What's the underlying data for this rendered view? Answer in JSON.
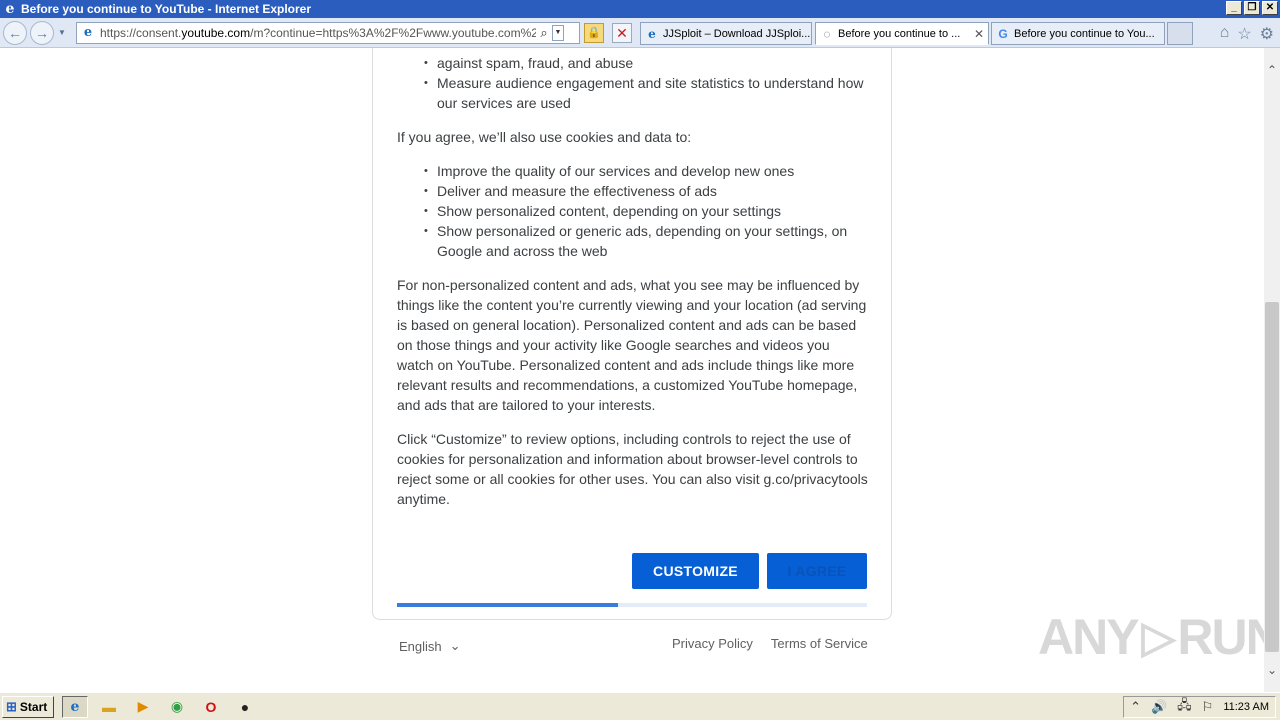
{
  "window": {
    "title": "Before you continue to YouTube - Internet Explorer",
    "btn_minimize": "_",
    "btn_restore": "❐",
    "btn_close": "✕"
  },
  "nav": {
    "back_glyph": "←",
    "forward_glyph": "→",
    "dropdown_glyph": "▼",
    "url_prefix": "https://consent.",
    "url_host": "youtube.com",
    "url_rest": "/m?continue=https%3A%2F%2Fwww.youtube.com%2Fchann",
    "lock_glyph": "🔒",
    "stop_glyph": "✕"
  },
  "tabs": [
    {
      "label": "JJSploit – Download JJSploi...",
      "icon": "e"
    },
    {
      "label": "Before you continue to ...",
      "icon": "◌"
    },
    {
      "label": "Before you continue to You...",
      "icon": "G"
    }
  ],
  "toolbar": {
    "home": "⌂",
    "favorites": "☆",
    "settings": "⚙"
  },
  "content": {
    "bullets_top": [
      "against spam, fraud, and abuse",
      "Measure audience engagement and site statistics to understand how our services are used"
    ],
    "agree_intro": "If you agree, we’ll also use cookies and data to:",
    "bullets_agree": [
      "Improve the quality of our services and develop new ones",
      "Deliver and measure the effectiveness of ads",
      "Show personalized content, depending on your settings",
      "Show personalized or generic ads, depending on your settings, on Google and across the web"
    ],
    "para_nonpersonalized": "For non-personalized content and ads, what you see may be influenced by things like the content you’re currently viewing and your location (ad serving is based on general location). Personalized content and ads can be based on those things and your activity like Google searches and videos you watch on YouTube. Personalized content and ads include things like more relevant results and recommendations, a customized YouTube homepage, and ads that are tailored to your interests.",
    "para_customize": "Click “Customize” to review options, including controls to reject the use of cookies for personalization and information about browser-level controls to reject some or all cookies for other uses. You can also visit g.co/privacytools anytime.",
    "btn_customize": "CUSTOMIZE",
    "btn_agree": "I AGREE",
    "progress_fraction": 0.47,
    "language": "English",
    "language_chevron": "⌄",
    "privacy_policy": "Privacy Policy",
    "terms": "Terms of Service"
  },
  "watermark": {
    "left": "ANY",
    "right": "RUN"
  },
  "scroll": {
    "up": "⌃",
    "down": "⌄"
  },
  "taskbar": {
    "start": "Start",
    "clock": "11:23 AM",
    "tray_glyphs": [
      "⌃",
      "🔊",
      "🖧",
      "⚐"
    ]
  }
}
